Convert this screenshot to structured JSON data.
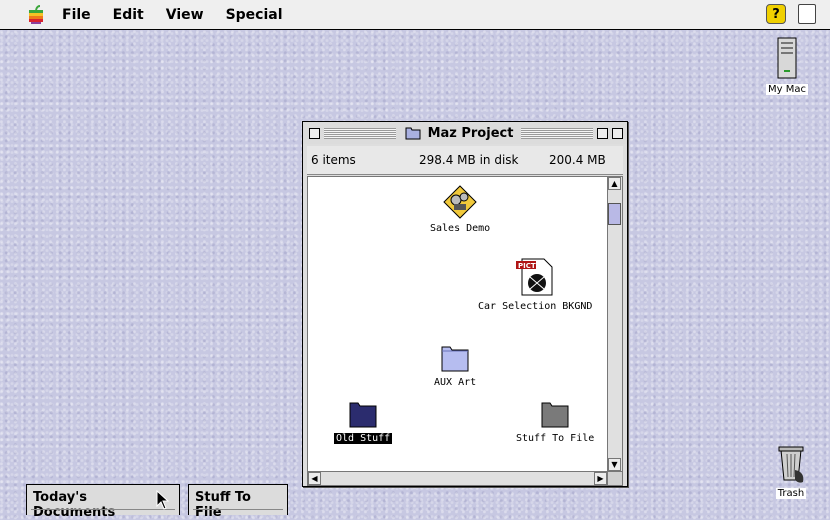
{
  "menubar": {
    "apple_icon": "apple-logo-icon",
    "menus": [
      "File",
      "Edit",
      "View",
      "Special"
    ],
    "help_label": "?"
  },
  "desktop": {
    "mymac": "My Mac",
    "trash": "Trash"
  },
  "window": {
    "title": "Maz Project",
    "items": "6 items",
    "disk": "298.4 MB in disk",
    "available": "200.4 MB",
    "files": [
      "Sales Demo",
      "Car Selection BKGND",
      "AUX Art",
      "Old Stuff",
      "Stuff To File"
    ],
    "pict_tag": "PICT"
  },
  "tabs": [
    "Today's Documents",
    "Stuff To File"
  ]
}
